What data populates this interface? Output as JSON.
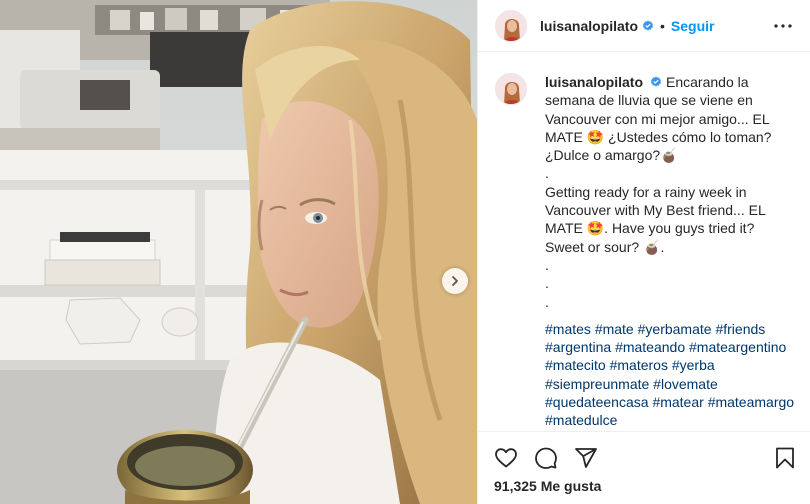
{
  "post": {
    "username": "luisanalopilato",
    "follow_label": "Seguir",
    "dot": "•",
    "caption": "Encarando la semana de lluvia que se viene en Vancouver con mi mejor amigo... EL MATE 🤩 ¿Ustedes cómo lo toman? ¿Dulce o amargo?🧉\n.\nGetting ready for a rainy week in Vancouver with My Best friend... EL MATE 🤩. Have you guys tried it? Sweet or sour? 🧉.\n.\n.\n.",
    "hashtags": [
      "#mates",
      "#mate",
      "#yerbamate",
      "#friends",
      "#argentina",
      "#mateando",
      "#mateargentino",
      "#matecito",
      "#materos",
      "#yerba",
      "#siempreunmate",
      "#lovemate",
      "#quedateencasa",
      "#matear",
      "#mateamargo",
      "#matedulce"
    ],
    "likes_count": "91,325",
    "likes_label": "Me gusta"
  },
  "colors": {
    "link_blue": "#0095f6",
    "hashtag_blue": "#00376b",
    "text": "#262626",
    "divider": "#efefef"
  },
  "icons": {
    "verified": "verified-badge-icon",
    "more": "more-options-icon",
    "like": "heart-icon",
    "comment": "comment-bubble-icon",
    "share": "paper-plane-icon",
    "save": "bookmark-icon",
    "next": "chevron-right-icon"
  }
}
